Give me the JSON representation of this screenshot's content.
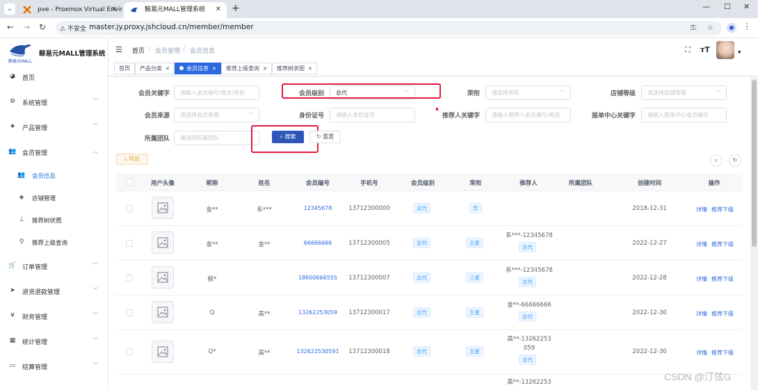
{
  "browser": {
    "tabs": [
      {
        "title": "pve - Proxmox Virtual Environ"
      },
      {
        "title": "鲸易元MALL管理系统"
      }
    ],
    "security_label": "不安全",
    "url": "master.jy.proxy.jshcloud.cn/member/member"
  },
  "app": {
    "logo_sub": "鲸易元MALL",
    "title": "鲸易元MALL管理系统"
  },
  "sidebar": {
    "items": [
      {
        "label": "首页",
        "icon": "dashboard-icon"
      },
      {
        "label": "系统管理",
        "icon": "gear-icon"
      },
      {
        "label": "产品管理",
        "icon": "star-icon"
      },
      {
        "label": "会员管理",
        "icon": "users-icon"
      },
      {
        "label": "订单管理",
        "icon": "cart-icon"
      },
      {
        "label": "退货退款管理",
        "icon": "send-icon"
      },
      {
        "label": "财务管理",
        "icon": "yen-icon"
      },
      {
        "label": "统计管理",
        "icon": "chart-icon"
      },
      {
        "label": "结算管理",
        "icon": "monitor-icon"
      }
    ],
    "member_sub": [
      {
        "label": "会员信息"
      },
      {
        "label": "店铺管理"
      },
      {
        "label": "推荐树状图"
      },
      {
        "label": "推荐上级查询"
      }
    ]
  },
  "breadcrumb": [
    "首页",
    "会员管理",
    "会员信息"
  ],
  "tagsview": [
    {
      "label": "首页"
    },
    {
      "label": "产品分类"
    },
    {
      "label": "会员信息"
    },
    {
      "label": "推荐上级查询"
    },
    {
      "label": "推荐树状图"
    }
  ],
  "filters": {
    "keyword": {
      "label": "会员关键字",
      "placeholder": "请输入会员编号/姓名/手机"
    },
    "level": {
      "label": "会员级别",
      "value": "总代"
    },
    "honor": {
      "label": "荣衔",
      "placeholder": "请选择荣衔"
    },
    "store_level": {
      "label": "店铺等级",
      "placeholder": "请选择店铺等级"
    },
    "source": {
      "label": "会员来源",
      "placeholder": "请选择会员来源"
    },
    "id_card": {
      "label": "身份证号",
      "placeholder": "请输入身份证号"
    },
    "referrer": {
      "label": "推荐人关键字",
      "placeholder": "请输入推荐人会员编号/姓名"
    },
    "center": {
      "label": "报单中心关键字",
      "placeholder": "请输入报单中心会员编号"
    },
    "team": {
      "label": "所属团队",
      "placeholder": "请选择所属团队"
    },
    "search_label": "搜索",
    "reset_label": "重置",
    "export_label": "导出"
  },
  "table": {
    "columns": [
      "用户头像",
      "昵称",
      "姓名",
      "会员编号",
      "手机号",
      "会员级别",
      "荣衔",
      "推荐人",
      "所属团队",
      "创建时间",
      "操作"
    ],
    "rows": [
      {
        "nickname": "金**",
        "name": "系***",
        "code": "12345678",
        "phone": "13712300000",
        "level": "总代",
        "honor": "无",
        "referrer": "",
        "referrer_level": "",
        "created": "2018-12-31"
      },
      {
        "nickname": "金**",
        "name": "金**",
        "code": "66666666",
        "phone": "13712300005",
        "level": "总代",
        "honor": "五星",
        "referrer": "系***-12345678",
        "referrer_level": "总代",
        "created": "2022-12-27"
      },
      {
        "nickname": "鲸*",
        "name": "",
        "code": "18600666555",
        "phone": "13712300007",
        "level": "总代",
        "honor": "三星",
        "referrer": "系***-12345678",
        "referrer_level": "总代",
        "created": "2022-12-28"
      },
      {
        "nickname": "Q",
        "name": "高**",
        "code": "13262253059",
        "phone": "13712300017",
        "level": "总代",
        "honor": "五星",
        "referrer": "金**-66666666",
        "referrer_level": "总代",
        "created": "2022-12-30"
      },
      {
        "nickname": "Q*",
        "name": "高**",
        "code": "132622530591",
        "phone": "13712300018",
        "level": "总代",
        "honor": "五星",
        "referrer_line1": "高**-13262253",
        "referrer_line2": "059",
        "referrer_level": "总代",
        "created": "2022-12-30"
      },
      {
        "referrer_line1": "高**-13262253"
      }
    ],
    "action_detail": "详情",
    "action_sub": "推荐下级"
  },
  "watermark": "CSDN @汀弦G"
}
